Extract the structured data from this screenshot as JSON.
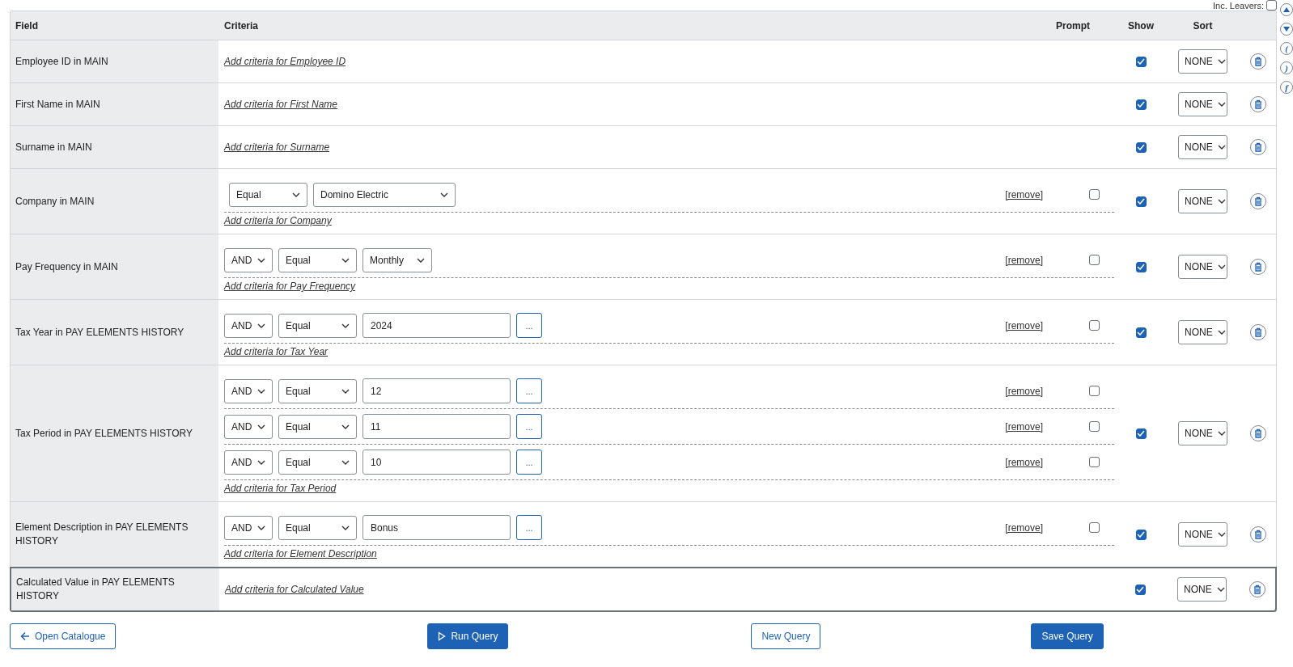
{
  "inc_leavers": {
    "label": "Inc. Leavers:",
    "checked": false
  },
  "columns": [
    "Field",
    "Criteria",
    "Prompt",
    "Show",
    "Sort"
  ],
  "rows": [
    {
      "field": "Employee ID in MAIN",
      "criteria": [],
      "add_link": "Add criteria for Employee ID",
      "show": true,
      "sort": "NONE",
      "selected": false
    },
    {
      "field": "First Name in MAIN",
      "criteria": [],
      "add_link": "Add criteria for First Name",
      "show": true,
      "sort": "NONE",
      "selected": false
    },
    {
      "field": "Surname in MAIN",
      "criteria": [],
      "add_link": "Add criteria for Surname",
      "show": true,
      "sort": "NONE",
      "selected": false
    },
    {
      "field": "Company in MAIN",
      "criteria": [
        {
          "operator": "Equal",
          "value": "Domino Electric",
          "kind": "select",
          "remove": "[remove]",
          "prompt": false
        }
      ],
      "add_link": "Add criteria for Company",
      "show": true,
      "sort": "NONE",
      "selected": false
    },
    {
      "field": "Pay Frequency in MAIN",
      "criteria": [
        {
          "conjunction": "AND",
          "operator": "Equal",
          "value": "Monthly",
          "kind": "select",
          "remove": "[remove]",
          "prompt": false
        }
      ],
      "add_link": "Add criteria for Pay Frequency",
      "show": true,
      "sort": "NONE",
      "selected": false
    },
    {
      "field": "Tax Year in PAY ELEMENTS HISTORY",
      "criteria": [
        {
          "conjunction": "AND",
          "operator": "Equal",
          "value": "2024",
          "kind": "text",
          "lookup": "...",
          "remove": "[remove]",
          "prompt": false
        }
      ],
      "add_link": "Add criteria for Tax Year",
      "show": true,
      "sort": "NONE",
      "selected": false
    },
    {
      "field": "Tax Period in PAY ELEMENTS HISTORY",
      "criteria": [
        {
          "conjunction": "AND",
          "operator": "Equal",
          "value": "12",
          "kind": "text",
          "lookup": "...",
          "remove": "[remove]",
          "prompt": false
        },
        {
          "conjunction": "AND",
          "operator": "Equal",
          "value": "11",
          "kind": "text",
          "lookup": "...",
          "remove": "[remove]",
          "prompt": false
        },
        {
          "conjunction": "AND",
          "operator": "Equal",
          "value": "10",
          "kind": "text",
          "lookup": "...",
          "remove": "[remove]",
          "prompt": false
        }
      ],
      "add_link": "Add criteria for Tax Period",
      "show": true,
      "sort": "NONE",
      "selected": false
    },
    {
      "field": "Element Description in PAY ELEMENTS HISTORY",
      "criteria": [
        {
          "conjunction": "AND",
          "operator": "Equal",
          "value": "Bonus",
          "kind": "text",
          "lookup": "...",
          "remove": "[remove]",
          "prompt": false
        }
      ],
      "add_link": "Add criteria for Element Description",
      "show": true,
      "sort": "NONE",
      "selected": false
    },
    {
      "field": "Calculated Value in PAY ELEMENTS HISTORY",
      "criteria": [],
      "add_link": "Add criteria for Calculated Value",
      "show": true,
      "sort": "NONE",
      "selected": true
    }
  ],
  "side_buttons": [
    {
      "kind": "up"
    },
    {
      "kind": "down"
    },
    {
      "kind": "text",
      "label": "("
    },
    {
      "kind": "text",
      "label": ")"
    },
    {
      "kind": "text",
      "label": "f"
    }
  ],
  "buttons": [
    {
      "label": "Open Catalogue",
      "kind": "secondary"
    },
    {
      "label": "Run Query",
      "kind": "primary"
    },
    {
      "label": "New Query",
      "kind": "secondary"
    },
    {
      "label": "Save Query",
      "kind": "primary"
    }
  ]
}
